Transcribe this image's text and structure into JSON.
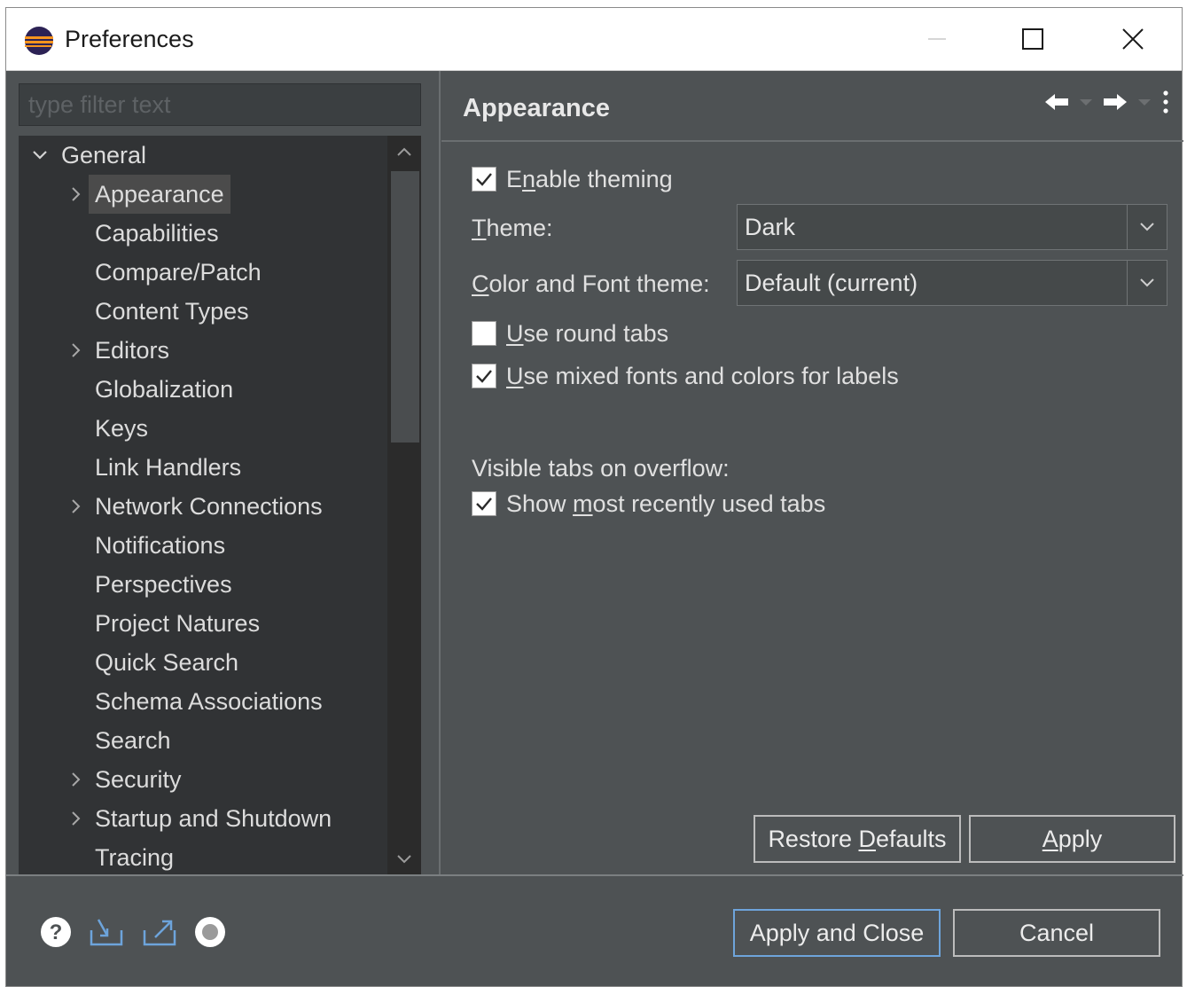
{
  "window": {
    "title": "Preferences",
    "controls": {
      "minimize": "minimize",
      "maximize": "maximize",
      "close": "close"
    }
  },
  "sidebar": {
    "filter_placeholder": "type filter text",
    "items": [
      {
        "label": "General",
        "level": 0,
        "expander": "expanded",
        "selected": false
      },
      {
        "label": "Appearance",
        "level": 1,
        "expander": "collapsed",
        "selected": true
      },
      {
        "label": "Capabilities",
        "level": 1,
        "expander": "none",
        "selected": false
      },
      {
        "label": "Compare/Patch",
        "level": 1,
        "expander": "none",
        "selected": false
      },
      {
        "label": "Content Types",
        "level": 1,
        "expander": "none",
        "selected": false
      },
      {
        "label": "Editors",
        "level": 1,
        "expander": "collapsed",
        "selected": false
      },
      {
        "label": "Globalization",
        "level": 1,
        "expander": "none",
        "selected": false
      },
      {
        "label": "Keys",
        "level": 1,
        "expander": "none",
        "selected": false
      },
      {
        "label": "Link Handlers",
        "level": 1,
        "expander": "none",
        "selected": false
      },
      {
        "label": "Network Connections",
        "level": 1,
        "expander": "collapsed",
        "selected": false
      },
      {
        "label": "Notifications",
        "level": 1,
        "expander": "none",
        "selected": false
      },
      {
        "label": "Perspectives",
        "level": 1,
        "expander": "none",
        "selected": false
      },
      {
        "label": "Project Natures",
        "level": 1,
        "expander": "none",
        "selected": false
      },
      {
        "label": "Quick Search",
        "level": 1,
        "expander": "none",
        "selected": false
      },
      {
        "label": "Schema Associations",
        "level": 1,
        "expander": "none",
        "selected": false
      },
      {
        "label": "Search",
        "level": 1,
        "expander": "none",
        "selected": false
      },
      {
        "label": "Security",
        "level": 1,
        "expander": "collapsed",
        "selected": false
      },
      {
        "label": "Startup and Shutdown",
        "level": 1,
        "expander": "collapsed",
        "selected": false
      },
      {
        "label": "Tracing",
        "level": 1,
        "expander": "none",
        "selected": false
      }
    ]
  },
  "page": {
    "title": "Appearance",
    "nav_icons": [
      "back-arrow-icon",
      "back-dropdown-icon",
      "forward-arrow-icon",
      "forward-dropdown-icon",
      "view-menu-icon"
    ]
  },
  "settings": {
    "enable_theming": {
      "label": "Enable theming",
      "checked": true
    },
    "theme": {
      "label": "Theme:",
      "value": "Dark"
    },
    "color_font_theme": {
      "label": "Color and Font theme:",
      "value": "Default (current)"
    },
    "round_tabs": {
      "label": "Use round tabs",
      "checked": false
    },
    "mixed_fonts": {
      "label": "Use mixed fonts and colors for labels",
      "checked": true
    },
    "overflow_heading": "Visible tabs on overflow:",
    "show_mru_tabs": {
      "label": "Show most recently used tabs",
      "checked": true
    }
  },
  "page_buttons": {
    "restore_defaults": "Restore Defaults",
    "apply": "Apply"
  },
  "footer": {
    "icons": [
      "help-icon",
      "import-icon",
      "export-icon",
      "record-icon"
    ],
    "apply_close": "Apply and Close",
    "cancel": "Cancel"
  },
  "colors": {
    "background": "#4e5254",
    "tree_background": "#313335",
    "text": "#e0e0e0",
    "primary_border": "#6ea4db"
  }
}
